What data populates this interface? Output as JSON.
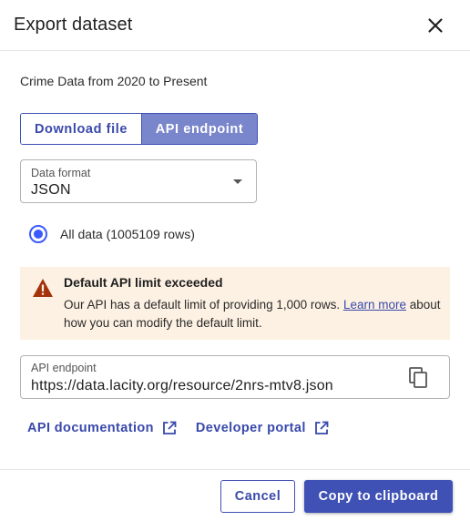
{
  "dialog": {
    "title": "Export dataset",
    "close_icon": "close-icon",
    "subtitle": "Crime Data from 2020 to Present"
  },
  "toggle": {
    "options": [
      "Download file",
      "API endpoint"
    ],
    "selected": "API endpoint"
  },
  "data_format": {
    "label": "Data format",
    "value": "JSON"
  },
  "scope": {
    "label": "All data (1005109 rows)",
    "selected": true
  },
  "alert": {
    "icon": "warning-icon",
    "title": "Default API limit exceeded",
    "body_prefix": "Our API has a default limit of providing 1,000 rows.",
    "link_text": "Learn more",
    "body_suffix": "about how you can modify the default limit."
  },
  "api_endpoint": {
    "label": "API endpoint",
    "value": "https://data.lacity.org/resource/2nrs-mtv8.json",
    "copy_icon": "copy-icon"
  },
  "links": [
    {
      "label": "API documentation",
      "icon": "external-link-icon"
    },
    {
      "label": "Developer portal",
      "icon": "external-link-icon"
    }
  ],
  "footer": {
    "cancel_label": "Cancel",
    "copy_label": "Copy to clipboard"
  },
  "colors": {
    "primary": "#3f51b5",
    "toggle_selected_bg": "#7986cb",
    "alert_bg": "#fdf1e3",
    "warning": "#a4330c",
    "radio": "#3d5afe"
  }
}
